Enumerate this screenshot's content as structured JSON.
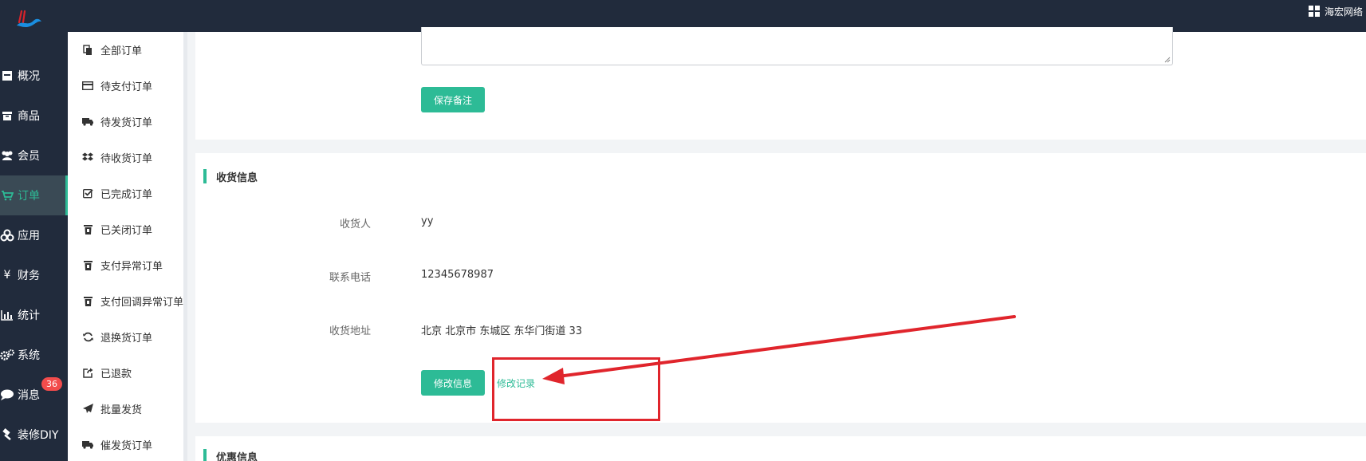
{
  "topbar": {
    "brand_label": "海宏网络",
    "logo_icon": "logo-mark",
    "brand_icon": "grid-icon"
  },
  "mainnav": {
    "items": [
      {
        "label": "概况",
        "icon": "dashboard-icon"
      },
      {
        "label": "商品",
        "icon": "box-icon"
      },
      {
        "label": "会员",
        "icon": "users-icon"
      },
      {
        "label": "订单",
        "icon": "cart-icon",
        "active": true
      },
      {
        "label": "应用",
        "icon": "cubes-icon"
      },
      {
        "label": "财务",
        "icon": "yen-icon"
      },
      {
        "label": "统计",
        "icon": "bar-chart-icon"
      },
      {
        "label": "系统",
        "icon": "gears-icon"
      },
      {
        "label": "消息",
        "icon": "chat-icon",
        "badge": "36"
      },
      {
        "label": "装修DIY",
        "icon": "hammer-icon"
      }
    ]
  },
  "submenu": {
    "items": [
      {
        "label": "全部订单",
        "icon": "copy-icon"
      },
      {
        "label": "待支付订单",
        "icon": "credit-card-icon"
      },
      {
        "label": "待发货订单",
        "icon": "truck-icon"
      },
      {
        "label": "待收货订单",
        "icon": "dropbox-icon"
      },
      {
        "label": "已完成订单",
        "icon": "check-square-icon"
      },
      {
        "label": "已关闭订单",
        "icon": "trash-icon"
      },
      {
        "label": "支付异常订单",
        "icon": "trash-icon"
      },
      {
        "label": "支付回调异常订单",
        "icon": "trash-icon"
      },
      {
        "label": "退换货订单",
        "icon": "refresh-icon"
      },
      {
        "label": "已退款",
        "icon": "share-icon"
      },
      {
        "label": "批量发货",
        "icon": "paper-plane-icon"
      },
      {
        "label": "催发货订单",
        "icon": "truck-icon"
      }
    ]
  },
  "remark": {
    "save_label": "保存备注"
  },
  "receiver": {
    "section_title": "收货信息",
    "name_label": "收货人",
    "name_value": "yy",
    "phone_label": "联系电话",
    "phone_value": "12345678987",
    "address_label": "收货地址",
    "address_value": "北京 北京市 东城区 东华门街道 33",
    "edit_label": "修改信息",
    "history_label": "修改记录"
  },
  "discount": {
    "section_title": "优惠信息"
  },
  "colors": {
    "accent": "#2dbb96",
    "sidebar": "#212b3c",
    "badge": "#f24c4c",
    "annotation": "#e0252c"
  }
}
